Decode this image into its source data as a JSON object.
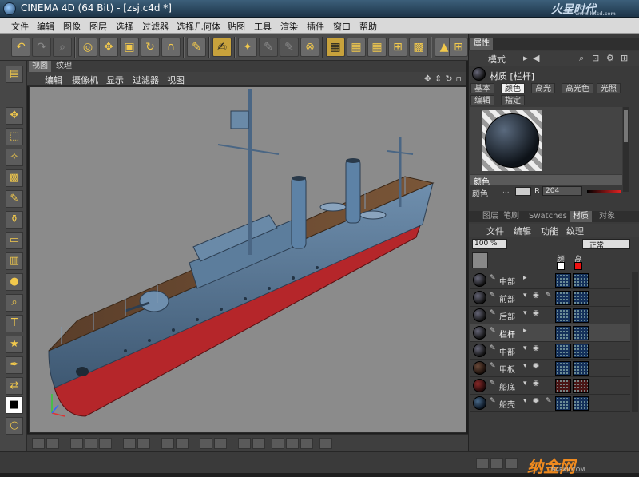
{
  "window": {
    "title": "CINEMA 4D (64 Bit) - [zsj.c4d *]",
    "watermark": "火星时代",
    "watermark_url": "www.hxsd.com"
  },
  "menubar": [
    "文件",
    "编辑",
    "图像",
    "图层",
    "选择",
    "过滤器",
    "选择几何体",
    "贴图",
    "工具",
    "渲染",
    "插件",
    "窗口",
    "帮助"
  ],
  "viewport": {
    "tabs": [
      "视图",
      "纹理"
    ],
    "menu": [
      "编辑",
      "摄像机",
      "显示",
      "过滤器",
      "视图"
    ],
    "nav_icons": [
      "move-icon",
      "arrows-icon",
      "rotate-icon",
      "maximize-icon"
    ]
  },
  "attributes": {
    "header": "属性",
    "mode": "模式",
    "material_label": "材质 [栏杆]",
    "tabs_row1": [
      "基本",
      "颜色",
      "高光",
      "高光色",
      "光照"
    ],
    "tabs_row2": [
      "编辑",
      "指定"
    ],
    "active_tab": "颜色",
    "section": "颜色",
    "color_label": "颜色",
    "channel": "R",
    "channel_value": "204"
  },
  "browser": {
    "tabs": [
      "图层",
      "笔刷",
      "Swatches",
      "材质",
      "对象"
    ],
    "active_tab": "材质",
    "menu": [
      "文件",
      "编辑",
      "功能",
      "纹理"
    ],
    "zoom": "100 %",
    "blend_mode": "正常",
    "col_a": "颜",
    "col_b": "高",
    "materials": [
      {
        "name": "中部",
        "tex": "blue"
      },
      {
        "name": "前部",
        "tex": "blue"
      },
      {
        "name": "后部",
        "tex": "blue"
      },
      {
        "name": "栏杆",
        "tex": "blue"
      },
      {
        "name": "中部",
        "tex": "blue"
      },
      {
        "name": "甲板",
        "tex": "blue"
      },
      {
        "name": "船底",
        "tex": "red"
      },
      {
        "name": "船壳",
        "tex": "blue"
      }
    ]
  },
  "footer_watermark": "纳金网",
  "footer_watermark_url": "NARKII.COM",
  "colors": {
    "accent": "#f08a1e",
    "panel": "#3a3a3a",
    "viewport_bg": "#8b8b8b",
    "hull_red": "#b5262a",
    "hull_blue": "#5b7a96"
  }
}
